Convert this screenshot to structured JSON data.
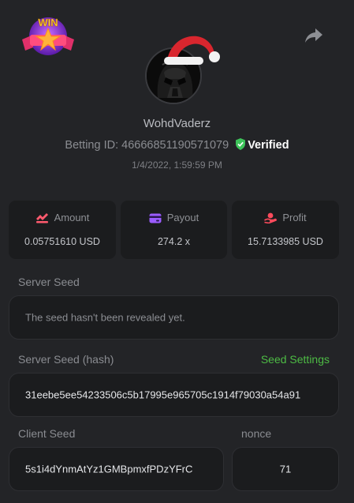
{
  "header": {
    "badge_text": "WIN",
    "username": "WohdVaderz",
    "betting_id_label": "Betting ID:",
    "betting_id": "46666851190571079",
    "verified_label": "Verified",
    "timestamp": "1/4/2022, 1:59:59 PM"
  },
  "stats": [
    {
      "label": "Amount",
      "value": "0.05751610 USD",
      "icon": "amount-icon",
      "color": "#ff5a6e"
    },
    {
      "label": "Payout",
      "value": "274.2 x",
      "icon": "payout-icon",
      "color": "#9b5cff"
    },
    {
      "label": "Profit",
      "value": "15.7133985 USD",
      "icon": "profit-icon",
      "color": "#ff4b5c"
    }
  ],
  "server_seed": {
    "label": "Server Seed",
    "value": "The seed hasn't been revealed yet."
  },
  "server_seed_hash": {
    "label": "Server Seed (hash)",
    "settings_link": "Seed Settings",
    "value": "31eebe5ee54233506c5b17995e965705c1914f79030a54a91"
  },
  "client_seed": {
    "label": "Client Seed",
    "value": "5s1i4dYnmAtYz1GMBpmxfPDzYFrC"
  },
  "nonce": {
    "label": "nonce",
    "value": "71"
  },
  "colors": {
    "accent_green": "#4dbb44",
    "verified_green": "#3ec45a",
    "background": "#232427",
    "card": "#1b1c1e"
  }
}
